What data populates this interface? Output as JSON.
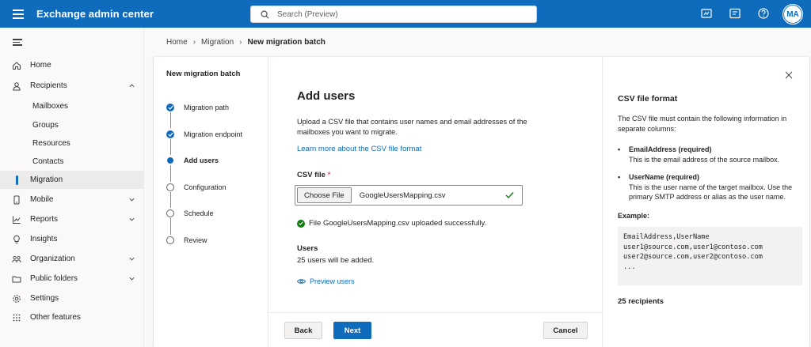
{
  "app": {
    "title": "Exchange admin center",
    "search_placeholder": "Search (Preview)",
    "user_initials": "MA"
  },
  "nav": {
    "items": [
      {
        "label": "Home",
        "icon": "home-icon"
      },
      {
        "label": "Recipients",
        "icon": "person-icon",
        "expanded": true
      },
      {
        "label": "Mailboxes"
      },
      {
        "label": "Groups"
      },
      {
        "label": "Resources"
      },
      {
        "label": "Contacts"
      },
      {
        "label": "Migration",
        "active": true
      },
      {
        "label": "Mobile",
        "icon": "mobile-icon"
      },
      {
        "label": "Reports",
        "icon": "chart-icon"
      },
      {
        "label": "Insights",
        "icon": "lightbulb-icon"
      },
      {
        "label": "Organization",
        "icon": "organization-icon"
      },
      {
        "label": "Public folders",
        "icon": "folder-icon"
      },
      {
        "label": "Settings",
        "icon": "gear-icon"
      },
      {
        "label": "Other features",
        "icon": "grid-icon"
      }
    ]
  },
  "breadcrumb": {
    "items": [
      "Home",
      "Migration",
      "New migration batch"
    ]
  },
  "wizard": {
    "title": "New migration batch",
    "steps": [
      {
        "label": "Migration path",
        "state": "done"
      },
      {
        "label": "Migration endpoint",
        "state": "done"
      },
      {
        "label": "Add users",
        "state": "current"
      },
      {
        "label": "Configuration",
        "state": "pending"
      },
      {
        "label": "Schedule",
        "state": "pending"
      },
      {
        "label": "Review",
        "state": "pending"
      }
    ]
  },
  "content": {
    "heading": "Add users",
    "description": "Upload a CSV file that contains user names and email addresses of the mailboxes you want to migrate.",
    "learn_link": "Learn more about the CSV file format",
    "csv_label": "CSV file",
    "required_mark": "*",
    "choose_file_label": "Choose File",
    "file_name": "GoogleUsersMapping.csv",
    "success_message": "File GoogleUsersMapping.csv uploaded successfully.",
    "users_heading": "Users",
    "users_count_text": "25 users will be added.",
    "preview_link": "Preview users"
  },
  "footer": {
    "back_label": "Back",
    "next_label": "Next",
    "cancel_label": "Cancel"
  },
  "info": {
    "title": "CSV file format",
    "description": "The CSV file must contain the following information in separate columns:",
    "bullet1_title": "EmailAddress (required)",
    "bullet1_desc": "This is the email address of the source mailbox.",
    "bullet2_title": "UserName (required)",
    "bullet2_desc": "This is the user name of the target mailbox. Use the primary SMTP address or alias as the user name.",
    "example_heading": "Example:",
    "example_code": "EmailAddress,UserName\nuser1@source.com,user1@contoso.com\nuser2@source.com,user2@contoso.com\n...",
    "recipients": "25 recipients"
  },
  "colors": {
    "brand": "#0f6cbd",
    "success": "#107c10",
    "required": "#c50f1f"
  }
}
